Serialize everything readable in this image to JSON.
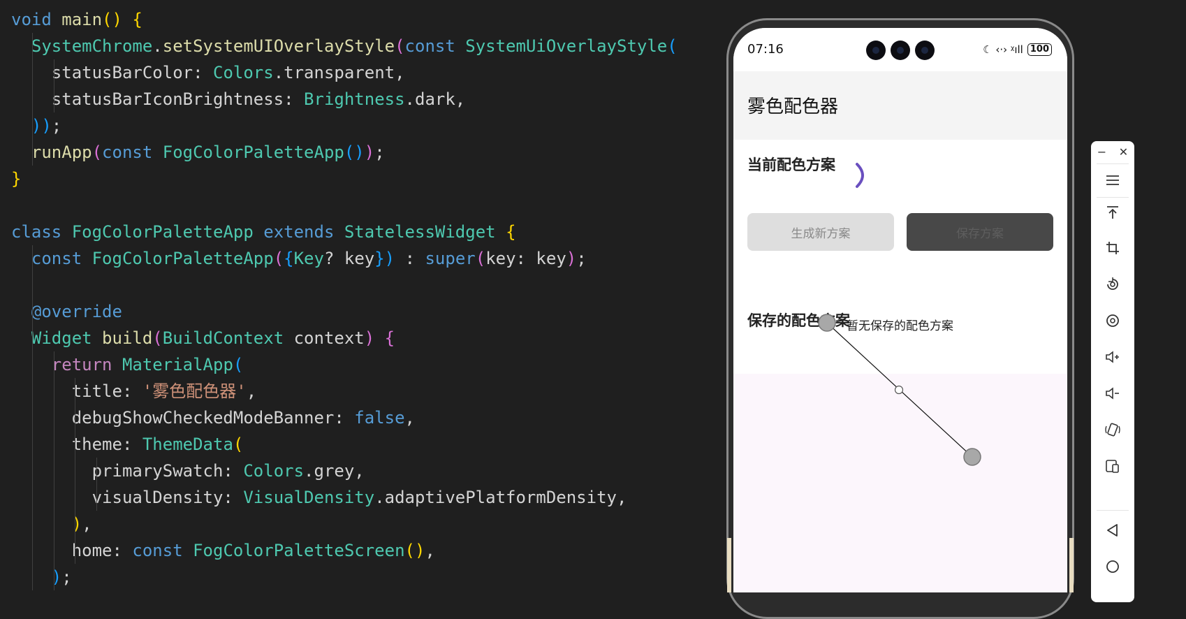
{
  "editor": {
    "lines": [
      [
        [
          "void",
          "#569cd6"
        ],
        [
          " ",
          ""
        ],
        [
          "main",
          "#dcdcaa"
        ],
        [
          "()",
          "#ffd700"
        ],
        [
          " ",
          ""
        ],
        [
          "{",
          "#ffd700"
        ]
      ],
      [
        [
          "  SystemChrome",
          "#4ec9b0"
        ],
        [
          ".",
          ""
        ],
        [
          "setSystemUIOverlayStyle",
          "#dcdcaa"
        ],
        [
          "(",
          "#da70d6"
        ],
        [
          "const",
          "#569cd6"
        ],
        [
          " ",
          ""
        ],
        [
          "SystemUiOverlayStyle",
          "#4ec9b0"
        ],
        [
          "(",
          "#179fff"
        ]
      ],
      [
        [
          "    statusBarColor",
          ""
        ],
        [
          ": ",
          ""
        ],
        [
          "Colors",
          "#4ec9b0"
        ],
        [
          ".transparent,",
          ""
        ]
      ],
      [
        [
          "    statusBarIconBrightness",
          ""
        ],
        [
          ": ",
          ""
        ],
        [
          "Brightness",
          "#4ec9b0"
        ],
        [
          ".dark,",
          ""
        ]
      ],
      [
        [
          "  ))",
          "#179fff"
        ],
        [
          ";",
          ""
        ]
      ],
      [
        [
          "  runApp",
          "#dcdcaa"
        ],
        [
          "(",
          "#da70d6"
        ],
        [
          "const",
          "#569cd6"
        ],
        [
          " ",
          ""
        ],
        [
          "FogColorPaletteApp",
          "#4ec9b0"
        ],
        [
          "()",
          "#179fff"
        ],
        [
          ")",
          "#da70d6"
        ],
        [
          ";",
          ""
        ]
      ],
      [
        [
          "}",
          "#ffd700"
        ]
      ],
      [
        [
          "",
          ""
        ]
      ],
      [
        [
          "class",
          "#569cd6"
        ],
        [
          " ",
          ""
        ],
        [
          "FogColorPaletteApp",
          "#4ec9b0"
        ],
        [
          " ",
          ""
        ],
        [
          "extends",
          "#569cd6"
        ],
        [
          " ",
          ""
        ],
        [
          "StatelessWidget",
          "#4ec9b0"
        ],
        [
          " ",
          ""
        ],
        [
          "{",
          "#ffd700"
        ]
      ],
      [
        [
          "  const",
          "#569cd6"
        ],
        [
          " ",
          ""
        ],
        [
          "FogColorPaletteApp",
          "#4ec9b0"
        ],
        [
          "(",
          "#da70d6"
        ],
        [
          "{",
          "#179fff"
        ],
        [
          "Key",
          "#4ec9b0"
        ],
        [
          "? key",
          ""
        ],
        [
          "})",
          "#179fff"
        ],
        [
          " : ",
          ""
        ],
        [
          "super",
          "#569cd6"
        ],
        [
          "(",
          "#da70d6"
        ],
        [
          "key: key",
          ""
        ],
        [
          ")",
          "#da70d6"
        ],
        [
          ";",
          ""
        ]
      ],
      [
        [
          "",
          ""
        ]
      ],
      [
        [
          "  @override",
          "#569cd6"
        ]
      ],
      [
        [
          "  Widget",
          "#4ec9b0"
        ],
        [
          " ",
          ""
        ],
        [
          "build",
          "#dcdcaa"
        ],
        [
          "(",
          "#da70d6"
        ],
        [
          "BuildContext",
          "#4ec9b0"
        ],
        [
          " context",
          ""
        ],
        [
          ")",
          "#da70d6"
        ],
        [
          " ",
          ""
        ],
        [
          "{",
          "#da70d6"
        ]
      ],
      [
        [
          "    return",
          "#c586c0"
        ],
        [
          " ",
          ""
        ],
        [
          "MaterialApp",
          "#4ec9b0"
        ],
        [
          "(",
          "#179fff"
        ]
      ],
      [
        [
          "      title: ",
          ""
        ],
        [
          "'雾色配色器'",
          "#ce9178"
        ],
        [
          ",",
          ""
        ]
      ],
      [
        [
          "      debugShowCheckedModeBanner: ",
          ""
        ],
        [
          "false",
          "#569cd6"
        ],
        [
          ",",
          ""
        ]
      ],
      [
        [
          "      theme: ",
          ""
        ],
        [
          "ThemeData",
          "#4ec9b0"
        ],
        [
          "(",
          "#ffd700"
        ]
      ],
      [
        [
          "        primarySwatch: ",
          ""
        ],
        [
          "Colors",
          "#4ec9b0"
        ],
        [
          ".grey,",
          ""
        ]
      ],
      [
        [
          "        visualDensity: ",
          ""
        ],
        [
          "VisualDensity",
          "#4ec9b0"
        ],
        [
          ".adaptivePlatformDensity,",
          ""
        ]
      ],
      [
        [
          "      )",
          "#ffd700"
        ],
        [
          ",",
          ""
        ]
      ],
      [
        [
          "      home: ",
          ""
        ],
        [
          "const",
          "#569cd6"
        ],
        [
          " ",
          ""
        ],
        [
          "FogColorPaletteScreen",
          "#4ec9b0"
        ],
        [
          "()",
          "#ffd700"
        ],
        [
          ",",
          ""
        ]
      ],
      [
        [
          "    )",
          "#179fff"
        ],
        [
          ";",
          ""
        ]
      ]
    ]
  },
  "phone": {
    "status_time": "07:16",
    "status_icons": "☾ ‹·› ᵡıll",
    "battery": "100",
    "app_title": "雾色配色器",
    "current_section": "当前配色方案",
    "generate_button": "生成新方案",
    "save_button": "保存方案",
    "saved_section": "保存的配色方案",
    "empty_message": "暂无保存的配色方案"
  },
  "toolbar": {
    "minimize": "−",
    "close": "✕",
    "items": [
      "menu-icon",
      "pin-top-icon",
      "crop-icon",
      "rotate-icon",
      "screenshot-icon",
      "volume-up-icon",
      "volume-down-icon",
      "shake-icon",
      "device-icon"
    ],
    "nav": [
      "back-icon",
      "home-icon"
    ]
  },
  "colors": {
    "editor_bg": "#1f1f1f",
    "default_text": "#d4d4d4",
    "keyword": "#569cd6",
    "type": "#4ec9b0",
    "function": "#dcdcaa",
    "string": "#ce9178",
    "spinner": "#6a4fbf"
  }
}
